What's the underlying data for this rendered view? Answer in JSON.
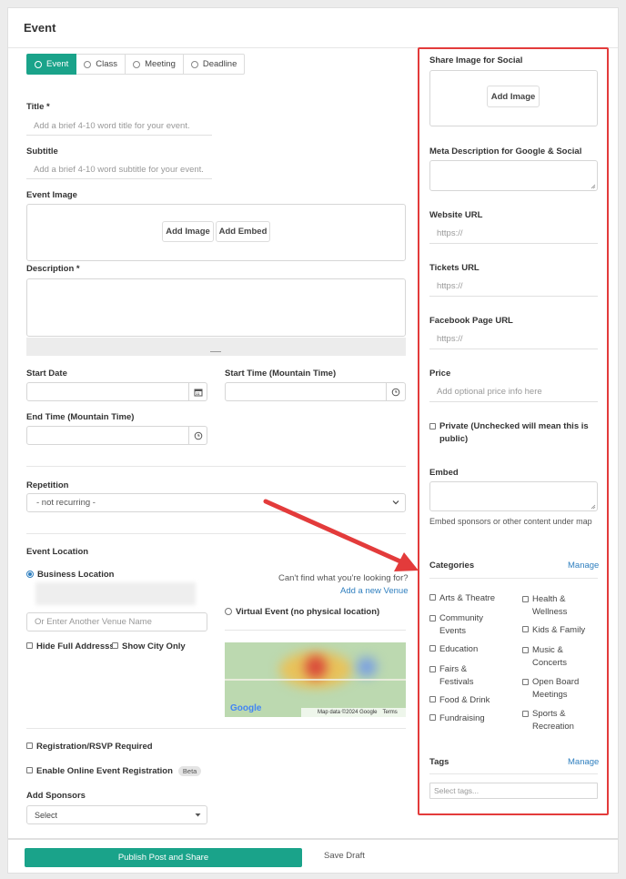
{
  "header": {
    "title": "Event"
  },
  "event_types": [
    {
      "label": "Event",
      "active": true
    },
    {
      "label": "Class",
      "active": false
    },
    {
      "label": "Meeting",
      "active": false
    },
    {
      "label": "Deadline",
      "active": false
    }
  ],
  "left": {
    "title_label": "Title *",
    "title_placeholder": "Add a brief 4-10 word title for your event.",
    "subtitle_label": "Subtitle",
    "subtitle_placeholder": "Add a brief 4-10 word subtitle for your event.",
    "image_label": "Event Image",
    "add_image": "Add Image",
    "add_embed": "Add Embed",
    "description_label": "Description *",
    "start_date_label": "Start Date",
    "start_time_label": "Start Time (Mountain Time)",
    "end_time_label": "End Time (Mountain Time)",
    "repetition_label": "Repetition",
    "repetition_value": "- not recurring -",
    "location_label": "Event Location",
    "business_location": "Business Location",
    "venue_placeholder": "Or Enter Another Venue Name",
    "cant_find": "Can't find what you're looking for?",
    "add_venue": "Add a new Venue",
    "virtual_event": "Virtual Event (no physical location)",
    "hide_address": "Hide Full Addresss",
    "show_city": "Show City Only",
    "map_attribution": "Map data ©2024 Google",
    "map_terms": "Terms",
    "map_logo": "Google",
    "registration": "Registration/RSVP Required",
    "online_registration": "Enable Online Event Registration",
    "beta_badge": "Beta",
    "sponsors_label": "Add Sponsors",
    "sponsors_value": "Select"
  },
  "right": {
    "share_image_label": "Share Image for Social",
    "add_image": "Add Image",
    "meta_label": "Meta Description for Google & Social",
    "website_label": "Website URL",
    "website_placeholder": "https://",
    "tickets_label": "Tickets URL",
    "tickets_placeholder": "https://",
    "facebook_label": "Facebook Page URL",
    "facebook_placeholder": "https://",
    "price_label": "Price",
    "price_placeholder": "Add optional price info here",
    "private_label": "Private (Unchecked will mean this is public)",
    "embed_label": "Embed",
    "embed_help": "Embed sponsors or other content under map",
    "categories_label": "Categories",
    "categories_manage": "Manage",
    "categories_left": [
      "Arts & Theatre",
      "Community Events",
      "Education",
      "Fairs & Festivals",
      "Food & Drink",
      "Fundraising"
    ],
    "categories_right": [
      "Health & Wellness",
      "Kids & Family",
      "Music & Concerts",
      "Open Board Meetings",
      "Sports & Recreation"
    ],
    "tags_label": "Tags",
    "tags_manage": "Manage",
    "tags_placeholder": "Select tags..."
  },
  "footer": {
    "publish": "Publish Post and Share",
    "save_draft": "Save Draft"
  },
  "colors": {
    "accent": "#1aa38a",
    "highlight": "#e33b3b",
    "link": "#2f7fbf"
  }
}
